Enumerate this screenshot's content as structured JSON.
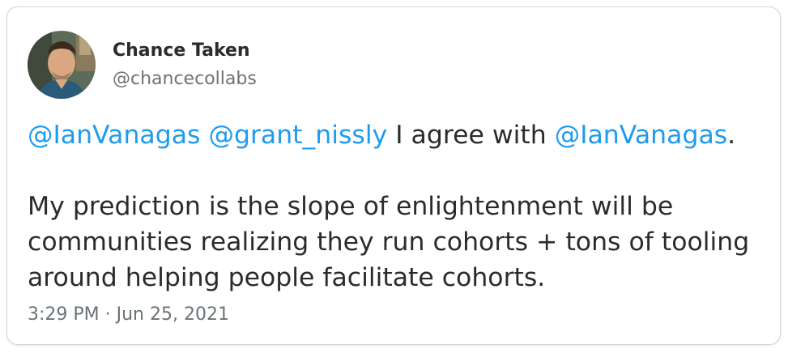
{
  "author": {
    "display_name": "Chance Taken",
    "handle": "@chancecollabs"
  },
  "tweet": {
    "mention_1": "@IanVanagas",
    "sep_1": " ",
    "mention_2": "@grant_nissly",
    "text_1": " I agree with ",
    "mention_3": "@IanVanagas",
    "text_2": ".",
    "line_2": "My prediction is the slope of enlightenment will be",
    "line_3": "communities realizing they run cohorts + tons of tooling",
    "line_4": "around helping people facilitate cohorts."
  },
  "timestamp": "3:29 PM · Jun 25, 2021",
  "colors": {
    "mention": "#1d9bf0",
    "text": "#2b2b2b",
    "muted": "#6b7378",
    "border": "#cfd9de"
  }
}
